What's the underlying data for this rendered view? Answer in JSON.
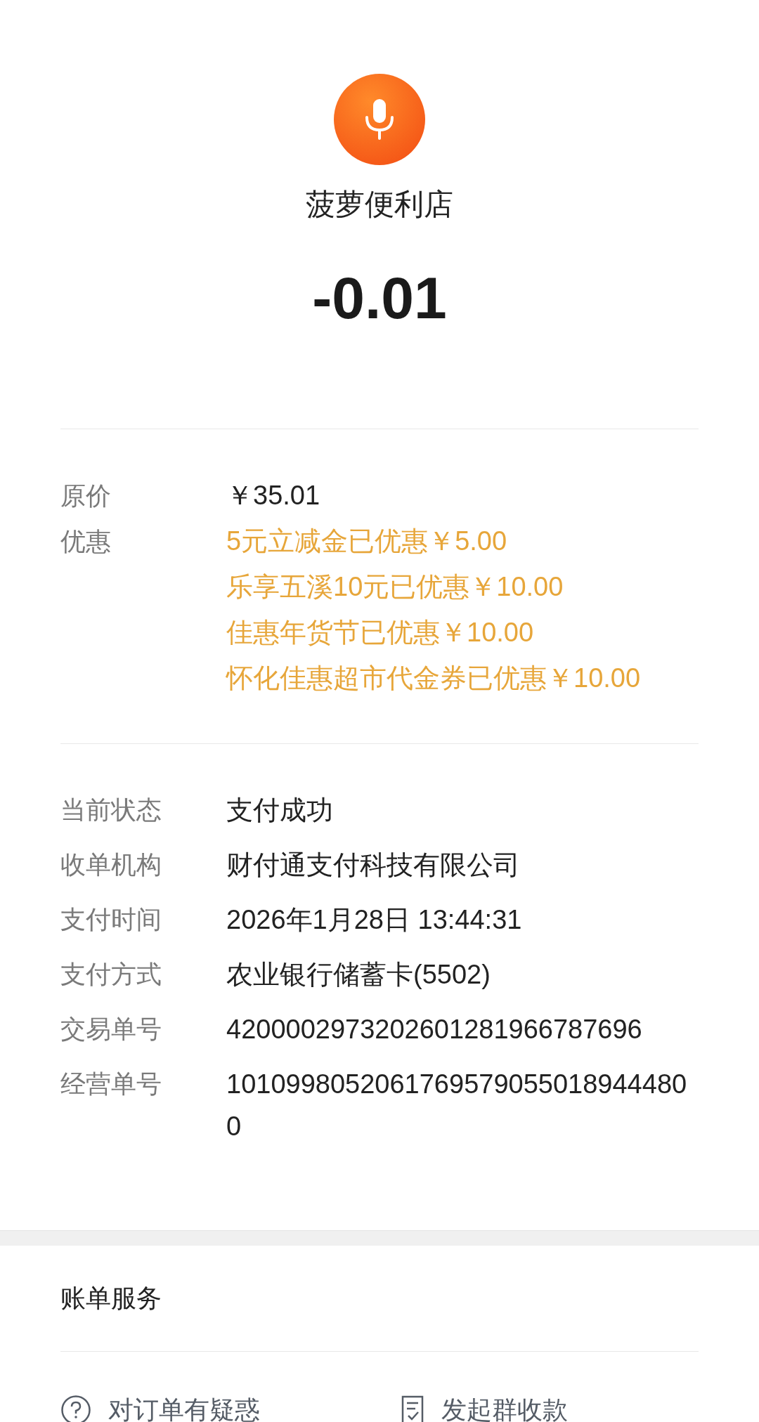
{
  "merchant": {
    "name": "菠萝便利店"
  },
  "amount": "-0.01",
  "price_rows": [
    {
      "label": "原价",
      "kind": "plain",
      "values": [
        "￥35.01"
      ]
    },
    {
      "label": "优惠",
      "kind": "discount",
      "values": [
        "5元立减金已优惠￥5.00",
        "乐享五溪10元已优惠￥10.00",
        "佳惠年货节已优惠￥10.00",
        "怀化佳惠超市代金券已优惠￥10.00"
      ]
    }
  ],
  "detail_rows": [
    {
      "label": "当前状态",
      "value": "支付成功"
    },
    {
      "label": "收单机构",
      "value": "财付通支付科技有限公司"
    },
    {
      "label": "支付时间",
      "value": "2026年1月28日 13:44:31"
    },
    {
      "label": "支付方式",
      "value": "农业银行储蓄卡(5502)"
    },
    {
      "label": "交易单号",
      "value": "4200002973202601281966787696"
    },
    {
      "label": "经营单号",
      "value": "10109980520617695790550189444800"
    }
  ],
  "services": {
    "title": "账单服务",
    "actions": [
      {
        "label": "对订单有疑惑",
        "kind": "question"
      },
      {
        "label": "发起群收款",
        "kind": "receipt"
      }
    ]
  }
}
